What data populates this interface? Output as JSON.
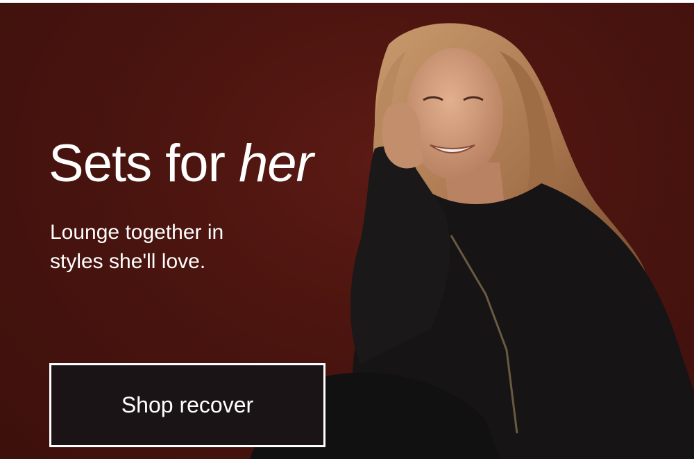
{
  "banner": {
    "headline_main": "Sets for ",
    "headline_accent": "her",
    "subtext": "Lounge together in styles she'll love.",
    "cta_label": "Shop recover"
  },
  "colors": {
    "background": "#4a140f",
    "button_background": "#1b1416",
    "button_border": "#ffffff",
    "text": "#ffffff"
  }
}
